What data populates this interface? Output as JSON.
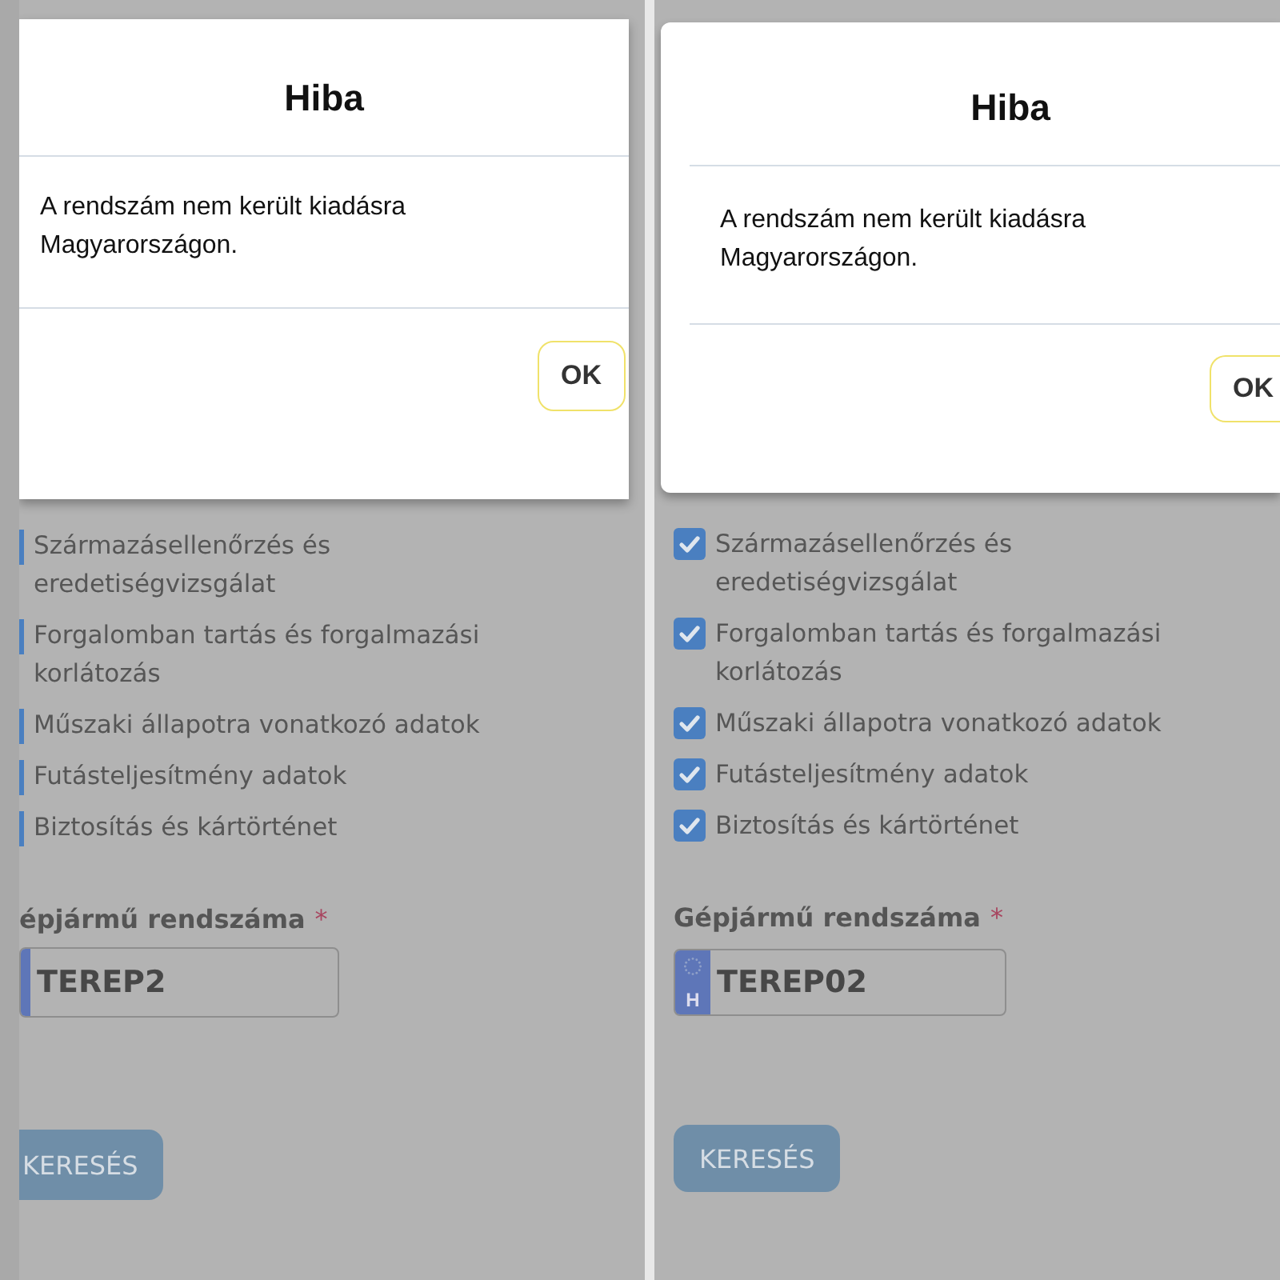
{
  "panels": [
    {
      "kind": "cropped",
      "dialog": {
        "title": "Hiba",
        "message": "A rendszám nem került kiadásra Magyarországon.",
        "button": "OK"
      },
      "checklist": [
        {
          "label": "Származásellenőrzés és eredetiségvizsgálat",
          "checked": true
        },
        {
          "label": "Forgalomban tartás és forgalmazási korlátozás",
          "checked": true
        },
        {
          "label": "Műszaki állapotra vonatkozó adatok",
          "checked": true
        },
        {
          "label": "Futásteljesítmény adatok",
          "checked": true
        },
        {
          "label": "Biztosítás és kártörténet",
          "checked": true
        }
      ],
      "plate_label": "épjármű rendszáma",
      "required_mark": "*",
      "plate_value": "TEREP2",
      "search_button": "KERESÉS"
    },
    {
      "kind": "full",
      "dialog": {
        "title": "Hiba",
        "message": "A rendszám nem került kiadásra Magyarországon.",
        "button": "OK"
      },
      "checklist": [
        {
          "label": "Származásellenőrzés és eredetiségvizsgálat",
          "checked": true
        },
        {
          "label": "Forgalomban tartás és forgalmazási korlátozás",
          "checked": true
        },
        {
          "label": "Műszaki állapotra vonatkozó adatok",
          "checked": true
        },
        {
          "label": "Futásteljesítmény adatok",
          "checked": true
        },
        {
          "label": "Biztosítás és kártörténet",
          "checked": true
        }
      ],
      "plate_label": "Gépjármű rendszáma",
      "required_mark": "*",
      "plate_country": "H",
      "plate_value": "TEREP02",
      "search_button": "KERESÉS"
    }
  ]
}
